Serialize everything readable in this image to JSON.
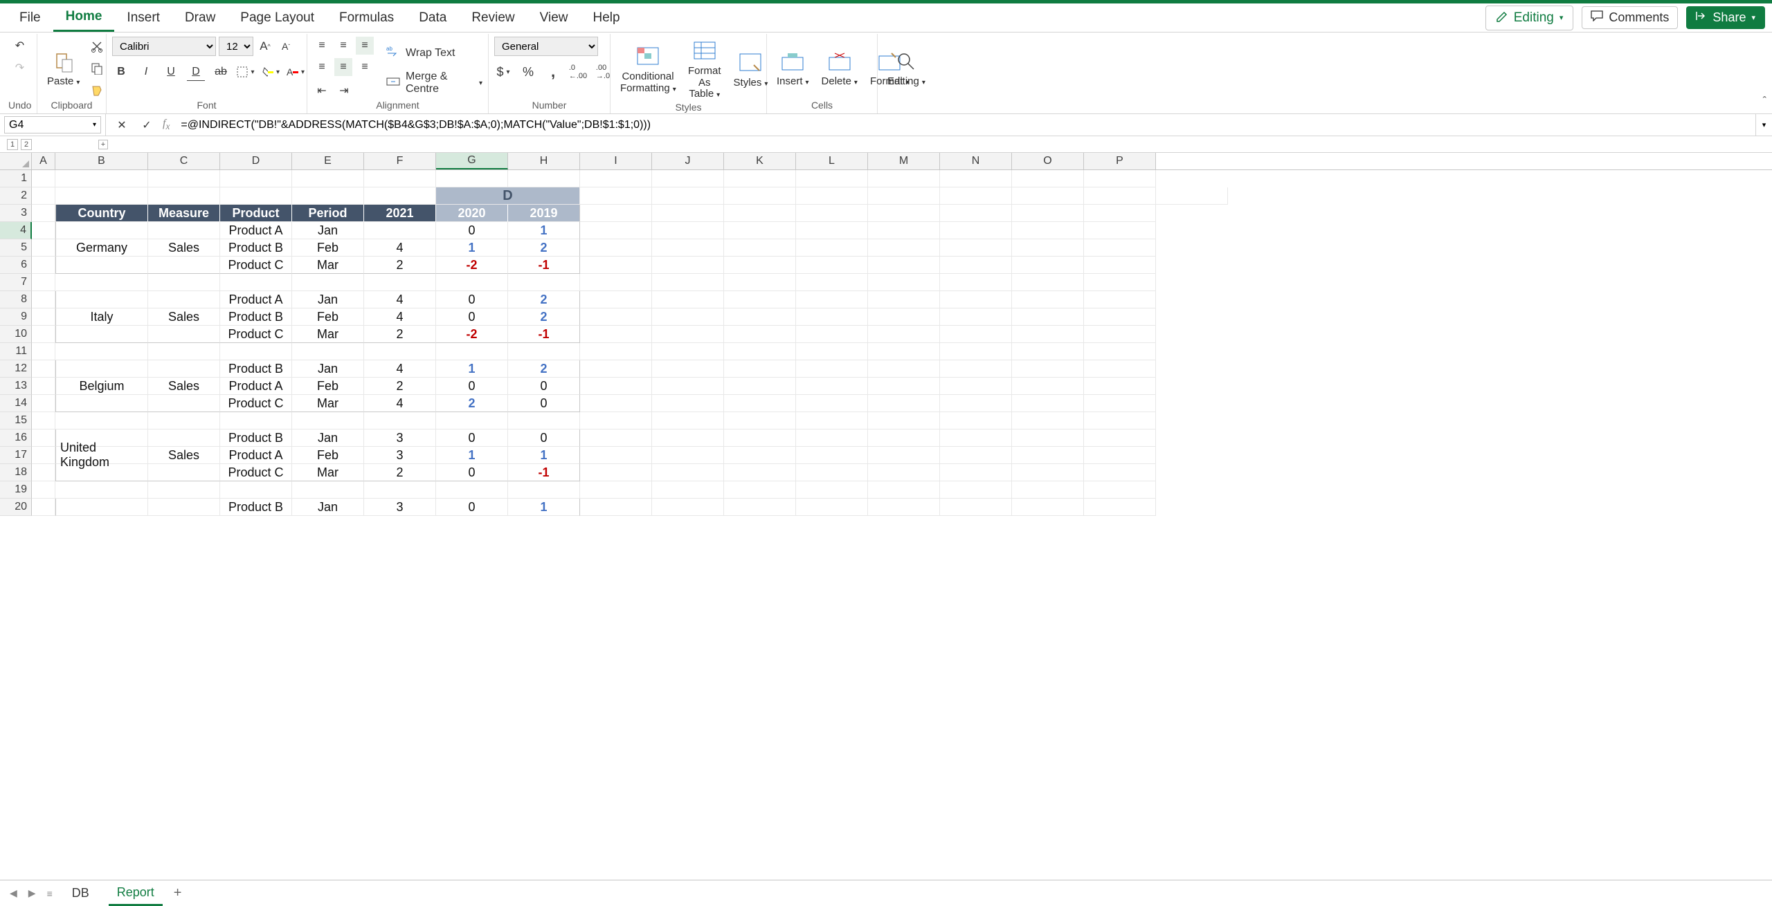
{
  "menu": {
    "tabs": [
      "File",
      "Home",
      "Insert",
      "Draw",
      "Page Layout",
      "Formulas",
      "Data",
      "Review",
      "View",
      "Help"
    ],
    "active": "Home",
    "editing": "Editing",
    "comments": "Comments",
    "share": "Share"
  },
  "ribbon": {
    "undo_label": "Undo",
    "clipboard": {
      "paste": "Paste",
      "label": "Clipboard"
    },
    "font": {
      "name": "Calibri",
      "size": "12",
      "label": "Font"
    },
    "alignment": {
      "wrap": "Wrap Text",
      "merge": "Merge & Centre",
      "label": "Alignment"
    },
    "number": {
      "format": "General",
      "label": "Number"
    },
    "styles": {
      "cond": "Conditional Formatting",
      "fat": "Format As Table",
      "styles": "Styles",
      "label": "Styles"
    },
    "cells": {
      "insert_": "Insert",
      "delete_": "Delete",
      "format_": "Format",
      "label": "Cells"
    },
    "editing": {
      "editing": "Editing"
    }
  },
  "formula_bar": {
    "name_box": "G4",
    "formula": "=@INDIRECT(\"DB!\"&ADDRESS(MATCH($B4&G$3;DB!$A:$A;0);MATCH(\"Value\";DB!$1:$1;0)))"
  },
  "outline": {
    "levels": [
      "1",
      "2"
    ],
    "plus": "+"
  },
  "columns": [
    "A",
    "B",
    "C",
    "D",
    "E",
    "F",
    "G",
    "H",
    "I",
    "J",
    "K",
    "L",
    "M",
    "N",
    "O",
    "P"
  ],
  "selected_col": "G",
  "selected_row": "4",
  "table": {
    "group_header": "D",
    "headers": [
      "Country",
      "Measure",
      "Product",
      "Period",
      "2021",
      "2020",
      "2019"
    ],
    "blocks": [
      {
        "country": "Germany",
        "measure": "Sales",
        "rows": [
          {
            "product": "Product A",
            "period": "Jan",
            "y21": "",
            "y20": "0",
            "y19": "1"
          },
          {
            "product": "Product B",
            "period": "Feb",
            "y21": "4",
            "y20": "1",
            "y19": "2"
          },
          {
            "product": "Product C",
            "period": "Mar",
            "y21": "2",
            "y20": "-2",
            "y19": "-1"
          }
        ]
      },
      {
        "country": "Italy",
        "measure": "Sales",
        "rows": [
          {
            "product": "Product A",
            "period": "Jan",
            "y21": "4",
            "y20": "0",
            "y19": "2"
          },
          {
            "product": "Product B",
            "period": "Feb",
            "y21": "4",
            "y20": "0",
            "y19": "2"
          },
          {
            "product": "Product C",
            "period": "Mar",
            "y21": "2",
            "y20": "-2",
            "y19": "-1"
          }
        ]
      },
      {
        "country": "Belgium",
        "measure": "Sales",
        "rows": [
          {
            "product": "Product B",
            "period": "Jan",
            "y21": "4",
            "y20": "1",
            "y19": "2"
          },
          {
            "product": "Product A",
            "period": "Feb",
            "y21": "2",
            "y20": "0",
            "y19": "0"
          },
          {
            "product": "Product C",
            "period": "Mar",
            "y21": "4",
            "y20": "2",
            "y19": "0"
          }
        ]
      },
      {
        "country": "United Kingdom",
        "measure": "Sales",
        "rows": [
          {
            "product": "Product B",
            "period": "Jan",
            "y21": "3",
            "y20": "0",
            "y19": "0"
          },
          {
            "product": "Product A",
            "period": "Feb",
            "y21": "3",
            "y20": "1",
            "y19": "1"
          },
          {
            "product": "Product C",
            "period": "Mar",
            "y21": "2",
            "y20": "0",
            "y19": "-1"
          }
        ]
      },
      {
        "country": "",
        "measure": "",
        "rows": [
          {
            "product": "Product B",
            "period": "Jan",
            "y21": "3",
            "y20": "0",
            "y19": "1"
          }
        ]
      }
    ]
  },
  "sheets": {
    "tabs": [
      "DB",
      "Report"
    ],
    "active": "Report"
  }
}
